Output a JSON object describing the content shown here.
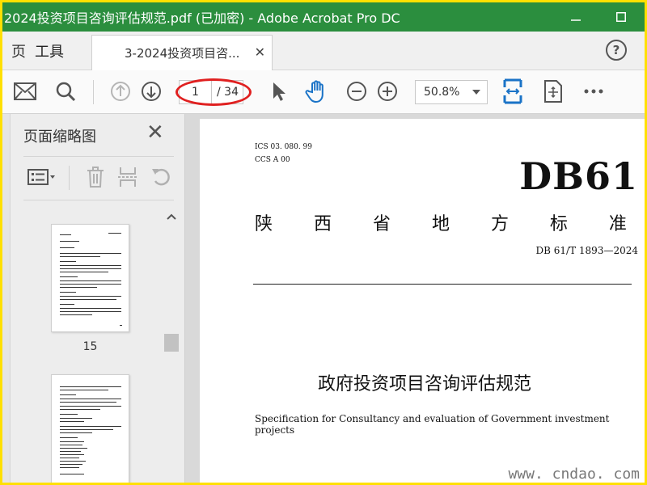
{
  "window": {
    "title": "2024投资项目咨询评估规范.pdf (已加密) - Adobe Acrobat Pro DC"
  },
  "tabs": {
    "home_partial": "页",
    "tools": "工具",
    "document": "3-2024投资项目咨...",
    "help": "?"
  },
  "toolbar": {
    "current_page": "1",
    "total_pages": "/ 34",
    "zoom": "50.8%"
  },
  "left_panel": {
    "title": "页面缩略图",
    "thumbnails": [
      {
        "page_label": "15"
      }
    ]
  },
  "document": {
    "ics": "ICS  03. 080. 99",
    "ccs": "CCS  A  00",
    "code": "DB61",
    "province_chars": [
      "陕",
      "西",
      "省",
      "地",
      "方",
      "标",
      "准"
    ],
    "standard_number": "DB 61/T 1893—2024",
    "title_cn": "政府投资项目咨询评估规范",
    "title_en": "Specification for Consultancy and evaluation of Government investment projects"
  },
  "watermark": "www. cndao. com",
  "colors": {
    "titlebar": "#2b8e3e",
    "frame": "#ffe000",
    "accent_blue": "#1a73c7",
    "highlight_red": "#e02020"
  }
}
